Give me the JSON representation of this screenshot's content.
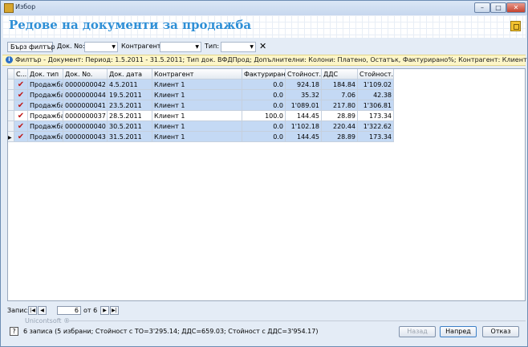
{
  "window": {
    "title": "Избор",
    "min": "–",
    "max": "□",
    "close": "✕"
  },
  "header": {
    "title": "Редове на документи за продажба"
  },
  "toolbar": {
    "quick_filter": "Бърз филтър",
    "doc_no_label": "Док. No:",
    "counterparty_label": "Контрагент:",
    "type_label": "Тип:",
    "clear": "✕"
  },
  "filter_text": "Филтър - Документ: Период: 1.5.2011 - 31.5.2011; Тип док. ВФДПрод; Допълнителни: Колони: Платено, Остатък, Фактурирано%; Контрагент: Клиент 1",
  "columns": [
    "С...",
    "Док. тип",
    "Док. No.",
    "Док. дата",
    "Контрагент",
    "Фактуриран...",
    "Стойност...",
    "ДДС",
    "Стойност..."
  ],
  "rows": [
    {
      "selected": true,
      "check": "✔",
      "type": "Продажба",
      "no": "0000000042",
      "date": "4.5.2011",
      "party": "Клиент 1",
      "invoiced": "0.0",
      "value": "924.18",
      "vat": "184.84",
      "total": "1'109.02"
    },
    {
      "selected": true,
      "check": "✔",
      "type": "Продажба",
      "no": "0000000044",
      "date": "19.5.2011",
      "party": "Клиент 1",
      "invoiced": "0.0",
      "value": "35.32",
      "vat": "7.06",
      "total": "42.38"
    },
    {
      "selected": true,
      "check": "✔",
      "type": "Продажба",
      "no": "0000000041",
      "date": "23.5.2011",
      "party": "Клиент 1",
      "invoiced": "0.0",
      "value": "1'089.01",
      "vat": "217.80",
      "total": "1'306.81"
    },
    {
      "selected": false,
      "check": "✔",
      "type": "Продажба",
      "no": "0000000037",
      "date": "28.5.2011",
      "party": "Клиент 1",
      "invoiced": "100.0",
      "value": "144.45",
      "vat": "28.89",
      "total": "173.34"
    },
    {
      "selected": true,
      "check": "✔",
      "type": "Продажба",
      "no": "0000000040",
      "date": "30.5.2011",
      "party": "Клиент 1",
      "invoiced": "0.0",
      "value": "1'102.18",
      "vat": "220.44",
      "total": "1'322.62"
    },
    {
      "selected": true,
      "check": "✔",
      "type": "Продажба",
      "no": "0000000043",
      "date": "31.5.2011",
      "party": "Клиент 1",
      "invoiced": "0.0",
      "value": "144.45",
      "vat": "28.89",
      "total": "173.34"
    }
  ],
  "nav": {
    "label": "Запис:",
    "current": "6",
    "of_text": "от 6"
  },
  "brand": "Unicontsoft ®",
  "summary": "6 записа (5 избрани; Стойност с ТО=3'295.14; ДДС=659.03; Стойност с ДДС=3'954.17)",
  "buttons": {
    "back": "Назад",
    "next": "Напред",
    "cancel": "Отказ"
  },
  "colors": {
    "title_blue": "#2e8fd6",
    "selected_row": "#c4d9f4",
    "check_red": "#c01818",
    "filter_bg": "#fdf6c8"
  }
}
